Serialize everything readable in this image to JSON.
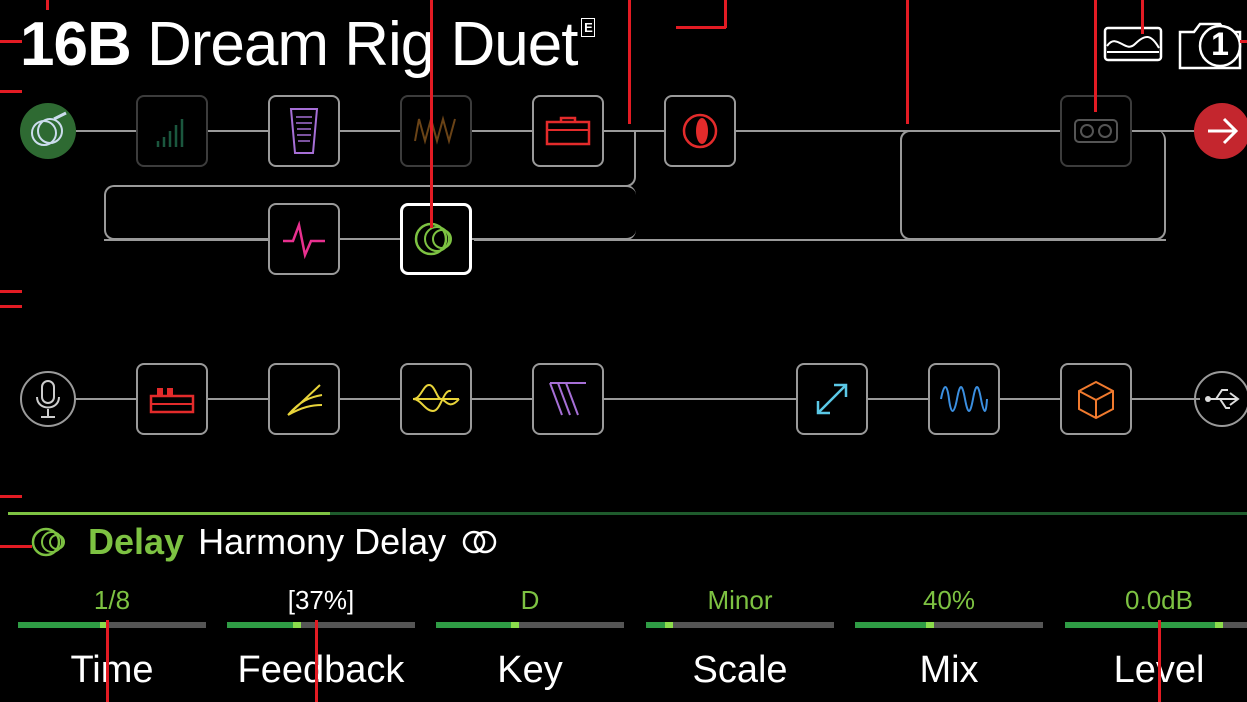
{
  "preset": {
    "number": "16B",
    "name": "Dream Rig Duet",
    "edited_badge": "E"
  },
  "top_right": {
    "snapshot_number": "1",
    "icons": [
      "signal-flow-view-icon",
      "snapshot-camera-icon"
    ]
  },
  "signal_paths": {
    "path1_blocks": [
      "guitar-input",
      "dynamics",
      "wah",
      "distortion",
      "amp",
      "cab",
      "looper",
      "output"
    ],
    "path1b_blocks": [
      "eq",
      "harmony-delay"
    ],
    "path2_blocks": [
      "mic-input",
      "preamp",
      "filter",
      "eq",
      "pitch",
      "modulation",
      "wave",
      "reverb",
      "usb-output"
    ]
  },
  "selected_block": {
    "category": "Delay",
    "model": "Harmony Delay",
    "stereo_icon": "stereo-icon"
  },
  "parameters": [
    {
      "label": "Time",
      "value": "1/8",
      "level": 0.46
    },
    {
      "label": "Feedback",
      "value": "[37%]",
      "level": 0.37
    },
    {
      "label": "Key",
      "value": "D",
      "level": 0.42
    },
    {
      "label": "Scale",
      "value": "Minor",
      "level": 0.12
    },
    {
      "label": "Mix",
      "value": "40%",
      "level": 0.4
    },
    {
      "label": "Level",
      "value": "0.0dB",
      "level": 0.82
    }
  ],
  "colors": {
    "background": "#000000",
    "accent_green": "#7dc242",
    "callout_red": "#e31b23",
    "output_red": "#c4262e",
    "wire_gray": "#9a9a9a"
  }
}
